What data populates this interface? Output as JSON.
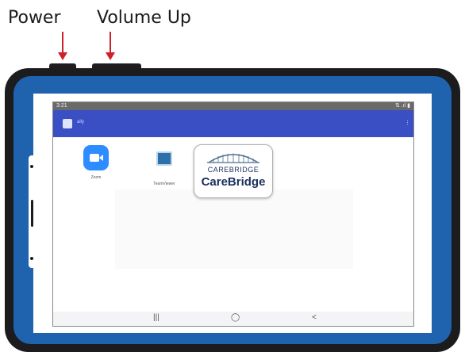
{
  "callouts": {
    "power_label": "Power",
    "volume_label": "Volume Up"
  },
  "phone": {
    "status_time": "3:21",
    "status_icons": "⇅ .ıl ▮",
    "appbar_title": "ally",
    "apps": [
      {
        "label": "Zoom",
        "icon": "zoom-video-icon"
      },
      {
        "label": "TeamViewer",
        "icon": "teamviewer-icon"
      }
    ],
    "nav": {
      "recents": "|||",
      "home": "◯",
      "back": "<"
    }
  },
  "popup": {
    "brand_small": "CAREBRIDGE",
    "brand_big": "CareBridge",
    "icon": "bridge-logo"
  },
  "colors": {
    "bezel": "#1f63ae",
    "appbar": "#3b4fc4",
    "arrow": "#d0202a",
    "zoom": "#2d8cff"
  }
}
